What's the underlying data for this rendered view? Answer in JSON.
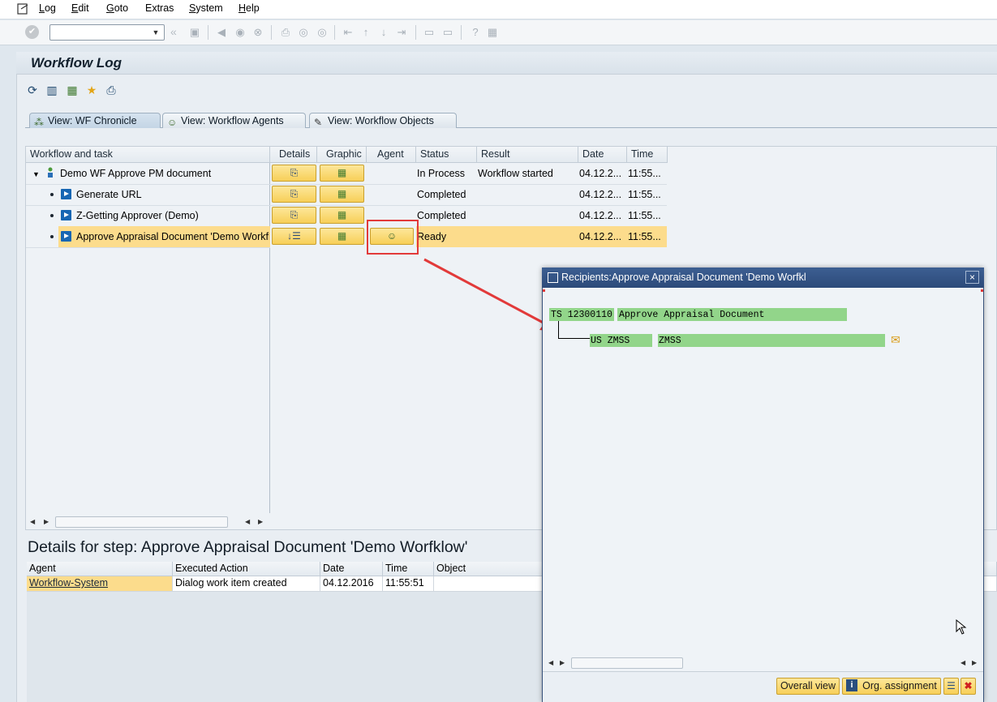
{
  "menu": {
    "items": [
      {
        "label": "Log",
        "u": "L",
        "rest": "og"
      },
      {
        "label": "Edit",
        "u": "E",
        "rest": "dit"
      },
      {
        "label": "Goto",
        "u": "G",
        "rest": "oto"
      },
      {
        "label": "Extras",
        "u": "",
        "rest": "Extras"
      },
      {
        "label": "System",
        "u": "S",
        "rest": "ystem"
      },
      {
        "label": "Help",
        "u": "H",
        "rest": "elp"
      }
    ]
  },
  "toolbar": {
    "command_value": "",
    "back_glyph": "«"
  },
  "page": {
    "title": "Workflow Log"
  },
  "tabs": [
    {
      "label": "View: WF Chronicle",
      "active": true
    },
    {
      "label": "View: Workflow Agents",
      "active": false
    },
    {
      "label": "View: Workflow Objects",
      "active": false
    }
  ],
  "grid": {
    "headers": [
      "Workflow and task",
      "Details",
      "Graphic",
      "Agent",
      "Status",
      "Result",
      "Date",
      "Time"
    ],
    "rows": [
      {
        "name": "Demo WF Approve PM document",
        "status": "In Process",
        "result": "Workflow started",
        "date": "04.12.2...",
        "time": "11:55..."
      },
      {
        "name": "Generate URL",
        "status": "Completed",
        "result": "",
        "date": "04.12.2...",
        "time": "11:55..."
      },
      {
        "name": "Z-Getting Approver (Demo)",
        "status": "Completed",
        "result": "",
        "date": "04.12.2...",
        "time": "11:55..."
      },
      {
        "name": "Approve Appraisal Document 'Demo Workflow'",
        "status": "Ready",
        "result": "",
        "date": "04.12.2...",
        "time": "11:55..."
      }
    ]
  },
  "details": {
    "title": "Details for step: Approve Appraisal Document 'Demo Worfklow'",
    "headers": [
      "Agent",
      "Executed Action",
      "Date",
      "Time",
      "Object"
    ],
    "rows": [
      {
        "agent": "Workflow-System",
        "action": "Dialog work item created",
        "date": "04.12.2016",
        "time": "11:55:51",
        "object": ""
      }
    ]
  },
  "popup": {
    "title": "Recipients:Approve Appraisal Document 'Demo Worfkl",
    "close_glyph": "×",
    "line1_code": "TS 12300110",
    "line1_text": "Approve Appraisal Document",
    "line2_code": "US ZMSS",
    "line2_text": "ZMSS",
    "buttons": {
      "overall_view": "Overall view",
      "org_assignment": "Org. assignment"
    }
  },
  "colors": {
    "highlight": "#e23a3a",
    "selected_row": "#fcdc8c",
    "green_node": "#92d58a"
  }
}
